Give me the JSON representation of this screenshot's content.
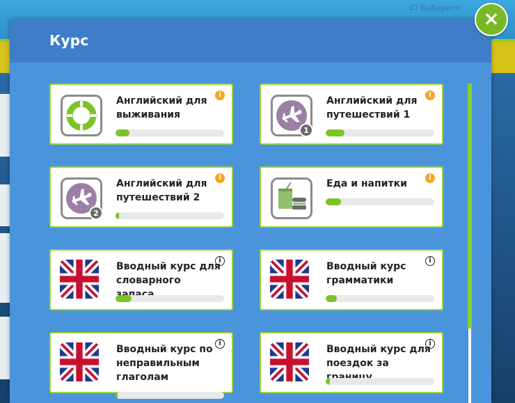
{
  "background": {
    "select_label": "Выберите"
  },
  "modal": {
    "title": "Курс",
    "close_label": "×"
  },
  "courses": [
    {
      "name": "Английский для выживания",
      "icon": "lifebuoy-icon",
      "progress": 0.13,
      "info_style": "orange"
    },
    {
      "name": "Английский для путешествий 1",
      "icon": "airplane-icon",
      "badge": "1",
      "progress": 0.17,
      "info_style": "orange"
    },
    {
      "name": "Английский для путешествий 2",
      "icon": "airplane-icon",
      "badge": "2",
      "progress": 0.03,
      "info_style": "orange"
    },
    {
      "name": "Еда и напитки",
      "icon": "food-drink-icon",
      "progress": 0.14,
      "info_style": "orange"
    },
    {
      "name": "Вводный курс для словарного запаса",
      "icon": "uk-flag-icon",
      "progress": 0.15,
      "info_style": "outline"
    },
    {
      "name": "Вводный курс грамматики",
      "icon": "uk-flag-icon",
      "progress": 0.1,
      "info_style": "outline"
    },
    {
      "name": "Вводный курс по неправильным глаголам",
      "icon": "uk-flag-icon",
      "progress": 0.02,
      "info_style": "outline"
    },
    {
      "name": "Вводный курс для поездок за границу",
      "icon": "uk-flag-icon",
      "progress": 0.04,
      "info_style": "outline"
    }
  ],
  "info_label": "i",
  "colors": {
    "accent_green": "#7ec22a",
    "modal_blue": "#4a94dc",
    "header_blue": "#3f7dc8",
    "info_orange": "#f5a623"
  }
}
